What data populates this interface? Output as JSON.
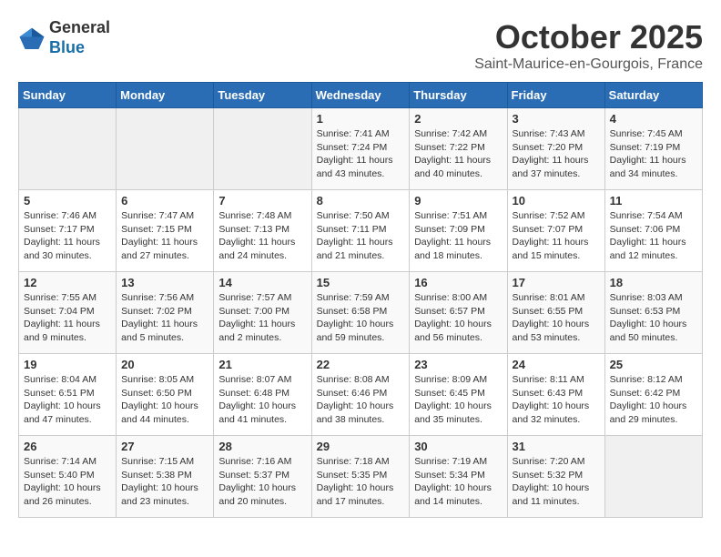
{
  "header": {
    "logo_general": "General",
    "logo_blue": "Blue",
    "month": "October 2025",
    "location": "Saint-Maurice-en-Gourgois, France"
  },
  "weekdays": [
    "Sunday",
    "Monday",
    "Tuesday",
    "Wednesday",
    "Thursday",
    "Friday",
    "Saturday"
  ],
  "weeks": [
    [
      {
        "day": "",
        "info": ""
      },
      {
        "day": "",
        "info": ""
      },
      {
        "day": "",
        "info": ""
      },
      {
        "day": "1",
        "info": "Sunrise: 7:41 AM\nSunset: 7:24 PM\nDaylight: 11 hours\nand 43 minutes."
      },
      {
        "day": "2",
        "info": "Sunrise: 7:42 AM\nSunset: 7:22 PM\nDaylight: 11 hours\nand 40 minutes."
      },
      {
        "day": "3",
        "info": "Sunrise: 7:43 AM\nSunset: 7:20 PM\nDaylight: 11 hours\nand 37 minutes."
      },
      {
        "day": "4",
        "info": "Sunrise: 7:45 AM\nSunset: 7:19 PM\nDaylight: 11 hours\nand 34 minutes."
      }
    ],
    [
      {
        "day": "5",
        "info": "Sunrise: 7:46 AM\nSunset: 7:17 PM\nDaylight: 11 hours\nand 30 minutes."
      },
      {
        "day": "6",
        "info": "Sunrise: 7:47 AM\nSunset: 7:15 PM\nDaylight: 11 hours\nand 27 minutes."
      },
      {
        "day": "7",
        "info": "Sunrise: 7:48 AM\nSunset: 7:13 PM\nDaylight: 11 hours\nand 24 minutes."
      },
      {
        "day": "8",
        "info": "Sunrise: 7:50 AM\nSunset: 7:11 PM\nDaylight: 11 hours\nand 21 minutes."
      },
      {
        "day": "9",
        "info": "Sunrise: 7:51 AM\nSunset: 7:09 PM\nDaylight: 11 hours\nand 18 minutes."
      },
      {
        "day": "10",
        "info": "Sunrise: 7:52 AM\nSunset: 7:07 PM\nDaylight: 11 hours\nand 15 minutes."
      },
      {
        "day": "11",
        "info": "Sunrise: 7:54 AM\nSunset: 7:06 PM\nDaylight: 11 hours\nand 12 minutes."
      }
    ],
    [
      {
        "day": "12",
        "info": "Sunrise: 7:55 AM\nSunset: 7:04 PM\nDaylight: 11 hours\nand 9 minutes."
      },
      {
        "day": "13",
        "info": "Sunrise: 7:56 AM\nSunset: 7:02 PM\nDaylight: 11 hours\nand 5 minutes."
      },
      {
        "day": "14",
        "info": "Sunrise: 7:57 AM\nSunset: 7:00 PM\nDaylight: 11 hours\nand 2 minutes."
      },
      {
        "day": "15",
        "info": "Sunrise: 7:59 AM\nSunset: 6:58 PM\nDaylight: 10 hours\nand 59 minutes."
      },
      {
        "day": "16",
        "info": "Sunrise: 8:00 AM\nSunset: 6:57 PM\nDaylight: 10 hours\nand 56 minutes."
      },
      {
        "day": "17",
        "info": "Sunrise: 8:01 AM\nSunset: 6:55 PM\nDaylight: 10 hours\nand 53 minutes."
      },
      {
        "day": "18",
        "info": "Sunrise: 8:03 AM\nSunset: 6:53 PM\nDaylight: 10 hours\nand 50 minutes."
      }
    ],
    [
      {
        "day": "19",
        "info": "Sunrise: 8:04 AM\nSunset: 6:51 PM\nDaylight: 10 hours\nand 47 minutes."
      },
      {
        "day": "20",
        "info": "Sunrise: 8:05 AM\nSunset: 6:50 PM\nDaylight: 10 hours\nand 44 minutes."
      },
      {
        "day": "21",
        "info": "Sunrise: 8:07 AM\nSunset: 6:48 PM\nDaylight: 10 hours\nand 41 minutes."
      },
      {
        "day": "22",
        "info": "Sunrise: 8:08 AM\nSunset: 6:46 PM\nDaylight: 10 hours\nand 38 minutes."
      },
      {
        "day": "23",
        "info": "Sunrise: 8:09 AM\nSunset: 6:45 PM\nDaylight: 10 hours\nand 35 minutes."
      },
      {
        "day": "24",
        "info": "Sunrise: 8:11 AM\nSunset: 6:43 PM\nDaylight: 10 hours\nand 32 minutes."
      },
      {
        "day": "25",
        "info": "Sunrise: 8:12 AM\nSunset: 6:42 PM\nDaylight: 10 hours\nand 29 minutes."
      }
    ],
    [
      {
        "day": "26",
        "info": "Sunrise: 7:14 AM\nSunset: 5:40 PM\nDaylight: 10 hours\nand 26 minutes."
      },
      {
        "day": "27",
        "info": "Sunrise: 7:15 AM\nSunset: 5:38 PM\nDaylight: 10 hours\nand 23 minutes."
      },
      {
        "day": "28",
        "info": "Sunrise: 7:16 AM\nSunset: 5:37 PM\nDaylight: 10 hours\nand 20 minutes."
      },
      {
        "day": "29",
        "info": "Sunrise: 7:18 AM\nSunset: 5:35 PM\nDaylight: 10 hours\nand 17 minutes."
      },
      {
        "day": "30",
        "info": "Sunrise: 7:19 AM\nSunset: 5:34 PM\nDaylight: 10 hours\nand 14 minutes."
      },
      {
        "day": "31",
        "info": "Sunrise: 7:20 AM\nSunset: 5:32 PM\nDaylight: 10 hours\nand 11 minutes."
      },
      {
        "day": "",
        "info": ""
      }
    ]
  ]
}
